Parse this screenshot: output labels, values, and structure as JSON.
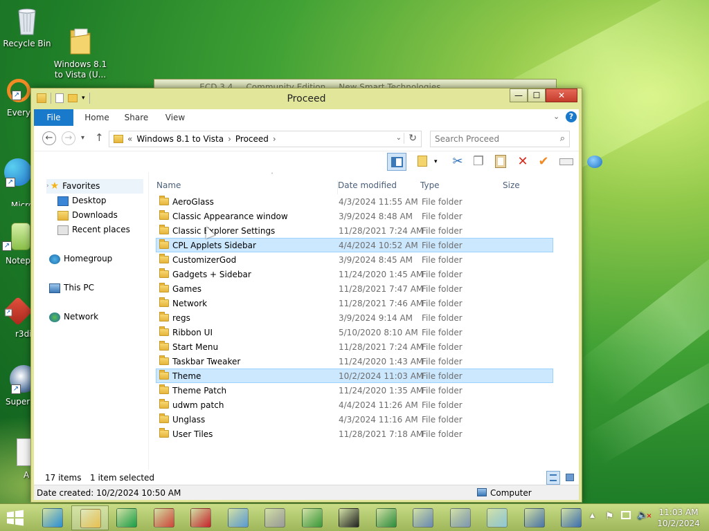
{
  "desktop": {
    "icons": [
      {
        "label": "Recycle Bin",
        "icon": "recycle-bin-icon"
      },
      {
        "label": "Windows 8.1\nto Vista (U...",
        "icon": "folder-icon"
      }
    ],
    "partial_icons": [
      {
        "label": "Everyt",
        "icon": "everything-icon",
        "color": "#f08a24"
      },
      {
        "label": "Micro\nEdg",
        "icon": "edge-icon",
        "color": "#1f8fd8"
      },
      {
        "label": "Notep",
        "icon": "notepad-icon",
        "color": "#9acd5a"
      },
      {
        "label": "r3di",
        "icon": "r3dir-icon",
        "color": "#d33b2c"
      },
      {
        "label": "Super",
        "icon": "superfetch-icon",
        "color": "#5e7fa8"
      },
      {
        "label": "A",
        "icon": "document-icon",
        "color": "#e8e8e8"
      }
    ]
  },
  "background_window": {
    "title": "... ECD 3.4 ... Community Edition ... New Smart Technologies"
  },
  "window": {
    "title": "Proceed",
    "controls": {
      "minimize": "—",
      "maximize": "☐",
      "close": "✕"
    },
    "ribbon_tabs": [
      "File",
      "Home",
      "Share",
      "View"
    ],
    "nav": {
      "back": "←",
      "forward": "→",
      "recent": "▾",
      "up": "↑",
      "path_prefix": "«",
      "path": [
        "Windows 8.1 to Vista",
        "Proceed"
      ],
      "separator": "›",
      "refresh": "↻",
      "search_placeholder": "Search Proceed"
    },
    "navpane": {
      "favorites": "Favorites",
      "favorite_items": [
        "Desktop",
        "Downloads",
        "Recent places"
      ],
      "homegroup": "Homegroup",
      "this_pc": "This PC",
      "network": "Network"
    },
    "columns": {
      "name": "Name",
      "date": "Date modified",
      "type": "Type",
      "size": "Size"
    },
    "files": [
      {
        "name": "AeroGlass",
        "date": "4/3/2024 11:55 AM",
        "type": "File folder",
        "selected": false
      },
      {
        "name": "Classic Appearance window",
        "date": "3/9/2024 8:48 AM",
        "type": "File folder",
        "selected": false
      },
      {
        "name": "Classic Explorer Settings",
        "date": "11/28/2021 7:24 AM",
        "type": "File folder",
        "selected": false
      },
      {
        "name": "CPL Applets Sidebar",
        "date": "4/4/2024 10:52 AM",
        "type": "File folder",
        "selected": true
      },
      {
        "name": "CustomizerGod",
        "date": "3/9/2024 8:45 AM",
        "type": "File folder",
        "selected": false
      },
      {
        "name": "Gadgets + Sidebar",
        "date": "11/24/2020 1:45 AM",
        "type": "File folder",
        "selected": false
      },
      {
        "name": "Games",
        "date": "11/28/2021 7:47 AM",
        "type": "File folder",
        "selected": false
      },
      {
        "name": "Network",
        "date": "11/28/2021 7:46 AM",
        "type": "File folder",
        "selected": false
      },
      {
        "name": "regs",
        "date": "3/9/2024 9:14 AM",
        "type": "File folder",
        "selected": false
      },
      {
        "name": "Ribbon UI",
        "date": "5/10/2020 8:10 AM",
        "type": "File folder",
        "selected": false
      },
      {
        "name": "Start Menu",
        "date": "11/28/2021 7:24 AM",
        "type": "File folder",
        "selected": false
      },
      {
        "name": "Taskbar Tweaker",
        "date": "11/24/2020 1:43 AM",
        "type": "File folder",
        "selected": false
      },
      {
        "name": "Theme",
        "date": "10/2/2024 11:03 AM",
        "type": "File folder",
        "selected": true
      },
      {
        "name": "Theme Patch",
        "date": "11/24/2020 1:35 AM",
        "type": "File folder",
        "selected": false
      },
      {
        "name": "udwm patch",
        "date": "4/4/2024 11:26 AM",
        "type": "File folder",
        "selected": false
      },
      {
        "name": "Unglass",
        "date": "4/3/2024 11:16 AM",
        "type": "File folder",
        "selected": false
      },
      {
        "name": "User Tiles",
        "date": "11/28/2021 7:18 AM",
        "type": "File folder",
        "selected": false
      }
    ],
    "status": {
      "count": "17 items",
      "selection": "1 item selected"
    },
    "details": {
      "created": "Date created: 10/2/2024 10:50 AM",
      "location": "Computer"
    }
  },
  "taskbar": {
    "apps": [
      {
        "icon": "internet-explorer-icon",
        "color": "#2c8fd6",
        "running": false
      },
      {
        "icon": "file-explorer-icon",
        "color": "#e8c050",
        "running": true
      },
      {
        "icon": "store-icon",
        "color": "#1aa048",
        "running": false
      },
      {
        "icon": "archive-app-icon",
        "color": "#d0463a",
        "running": false
      },
      {
        "icon": "red-circle-app-icon",
        "color": "#c8232c",
        "running": false
      },
      {
        "icon": "control-panel-icon",
        "color": "#5b9bd5",
        "running": false
      },
      {
        "icon": "printer-icon",
        "color": "#9a9a9a",
        "running": false
      },
      {
        "icon": "task-manager-icon",
        "color": "#3a9a3a",
        "running": false
      },
      {
        "icon": "7zip-icon",
        "color": "#222222",
        "running": false
      },
      {
        "icon": "download-manager-icon",
        "color": "#2d8e3d",
        "running": false
      },
      {
        "icon": "system-info-icon",
        "color": "#6a8ab5",
        "running": false
      },
      {
        "icon": "network-connections-icon",
        "color": "#7d97b3",
        "running": false
      },
      {
        "icon": "glass-app-icon",
        "color": "#8fc8d8",
        "running": false
      },
      {
        "icon": "computer-icon",
        "color": "#4a74a8",
        "running": false
      },
      {
        "icon": "remote-desktop-icon",
        "color": "#3d6fb0",
        "running": false
      }
    ],
    "tray": {
      "overflow": "▲",
      "time": "11:03 AM",
      "date": "10/2/2024"
    }
  }
}
